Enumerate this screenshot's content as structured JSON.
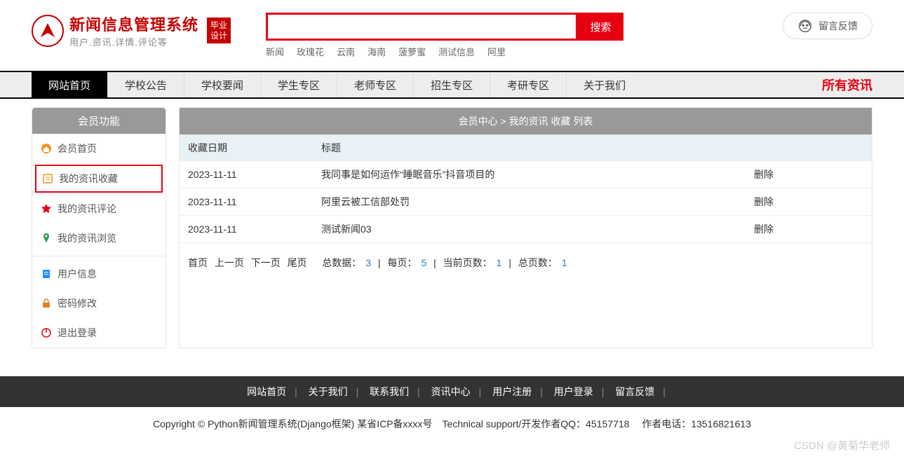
{
  "logo": {
    "title": "新闻信息管理系统",
    "subtitle": "用户.资讯.详情.评论等",
    "badge_line1": "毕业",
    "badge_line2": "设计"
  },
  "search": {
    "placeholder": "",
    "button": "搜索",
    "tags": [
      "新闻",
      "玫瑰花",
      "云南",
      "海南",
      "菠萝蜜",
      "测试信息",
      "阿里"
    ]
  },
  "feedback": {
    "label": "留言反馈"
  },
  "nav": {
    "items": [
      "网站首页",
      "学校公告",
      "学校要闻",
      "学生专区",
      "老师专区",
      "招生专区",
      "考研专区",
      "关于我们"
    ],
    "right": "所有资讯"
  },
  "sidebar": {
    "header": "会员功能",
    "items": [
      {
        "label": "会员首页",
        "icon": "home-icon",
        "color": "#f7931e"
      },
      {
        "label": "我的资讯收藏",
        "icon": "bookmark-icon",
        "color": "#f7931e",
        "highlight": true
      },
      {
        "label": "我的资讯评论",
        "icon": "star-icon",
        "color": "#e60012"
      },
      {
        "label": "我的资讯浏览",
        "icon": "pin-icon",
        "color": "#2ea44f"
      },
      {
        "divider": true
      },
      {
        "label": "用户信息",
        "icon": "clipboard-icon",
        "color": "#1e90ff"
      },
      {
        "label": "密码修改",
        "icon": "lock-icon",
        "color": "#e67e22"
      },
      {
        "label": "退出登录",
        "icon": "power-icon",
        "color": "#e60012"
      }
    ]
  },
  "main": {
    "header": "会员中心 > 我的资讯 收藏 列表",
    "columns": [
      "收藏日期",
      "标题",
      ""
    ],
    "rows": [
      {
        "date": "2023-11-11",
        "title": "我同事是如何运作“睡眠音乐”抖音项目的",
        "action": "删除"
      },
      {
        "date": "2023-11-11",
        "title": "阿里云被工信部处罚",
        "action": "删除"
      },
      {
        "date": "2023-11-11",
        "title": "测试新闻03",
        "action": "删除"
      }
    ],
    "pagination": {
      "first": "首页",
      "prev": "上一页",
      "next": "下一页",
      "last": "尾页",
      "total_label": "总数据：",
      "total": "3",
      "per_page_label": "每页：",
      "per_page": "5",
      "current_label": "当前页数：",
      "current": "1",
      "pages_label": "总页数：",
      "pages": "1"
    }
  },
  "footer": {
    "nav": [
      "网站首页",
      "关于我们",
      "联系我们",
      "资讯中心",
      "用户注册",
      "用户登录",
      "留言反馈"
    ],
    "copyright": "Copyright © Python新闻管理系统(Django框架) 某省ICP备xxxx号 Technical support/开发作者QQ：45157718  作者电话：13516821613"
  },
  "watermark": "CSDN @黄菊华老师"
}
